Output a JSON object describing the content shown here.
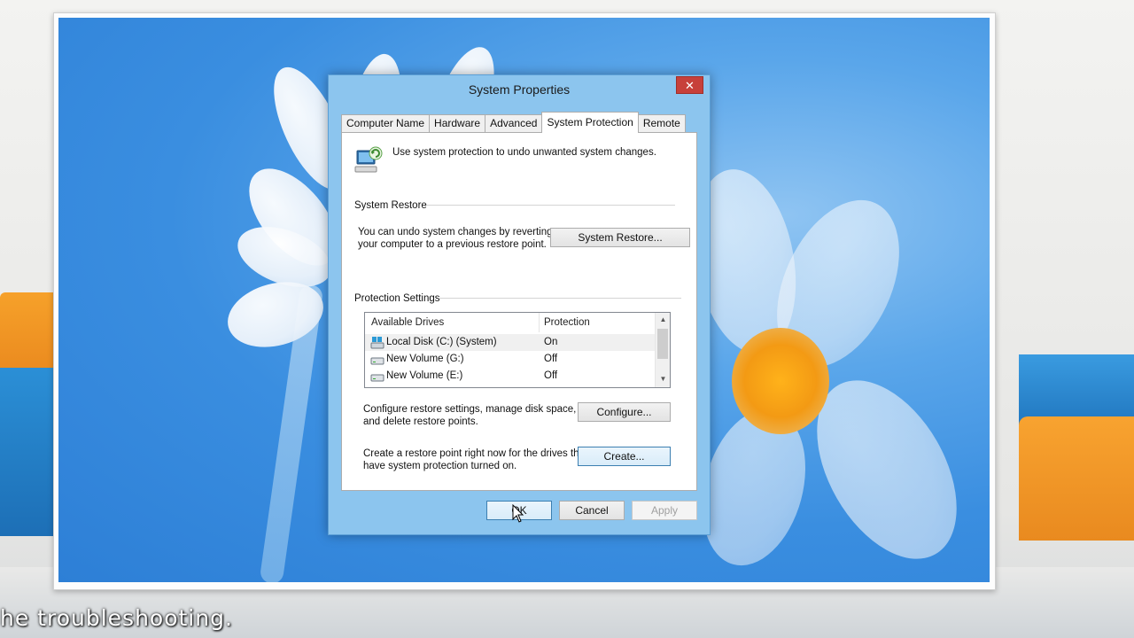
{
  "dialog": {
    "title": "System Properties",
    "close_glyph": "✕"
  },
  "tabs": [
    {
      "label": "Computer Name"
    },
    {
      "label": "Hardware"
    },
    {
      "label": "Advanced"
    },
    {
      "label": "System Protection",
      "active": true
    },
    {
      "label": "Remote"
    }
  ],
  "panel": {
    "intro_text": "Use system protection to undo unwanted system changes.",
    "system_restore": {
      "group_label": "System Restore",
      "description_line1": "You can undo system changes by reverting",
      "description_line2": "your computer to a previous restore point.",
      "button_label": "System Restore..."
    },
    "protection_settings": {
      "group_label": "Protection Settings",
      "columns": [
        "Available Drives",
        "Protection"
      ],
      "drives": [
        {
          "name": "Local Disk (C:) (System)",
          "protection": "On",
          "icon": "system-drive-icon",
          "selected": true
        },
        {
          "name": "New Volume (G:)",
          "protection": "Off",
          "icon": "drive-icon"
        },
        {
          "name": "New Volume (E:)",
          "protection": "Off",
          "icon": "drive-icon"
        }
      ],
      "configure_line1": "Configure restore settings, manage disk space,",
      "configure_line2": "and delete restore points.",
      "configure_button": "Configure...",
      "create_line1": "Create a restore point right now for the drives that",
      "create_line2": "have system protection turned on.",
      "create_button": "Create..."
    }
  },
  "footer": {
    "ok_label": "OK",
    "cancel_label": "Cancel",
    "apply_label": "Apply"
  },
  "caption": "he troubleshooting.",
  "colors": {
    "title_bar": "#8cc5ee",
    "close_button": "#c7403a",
    "desktop_blue": "#3a8ee0",
    "focus_border": "#3c7fb1"
  }
}
